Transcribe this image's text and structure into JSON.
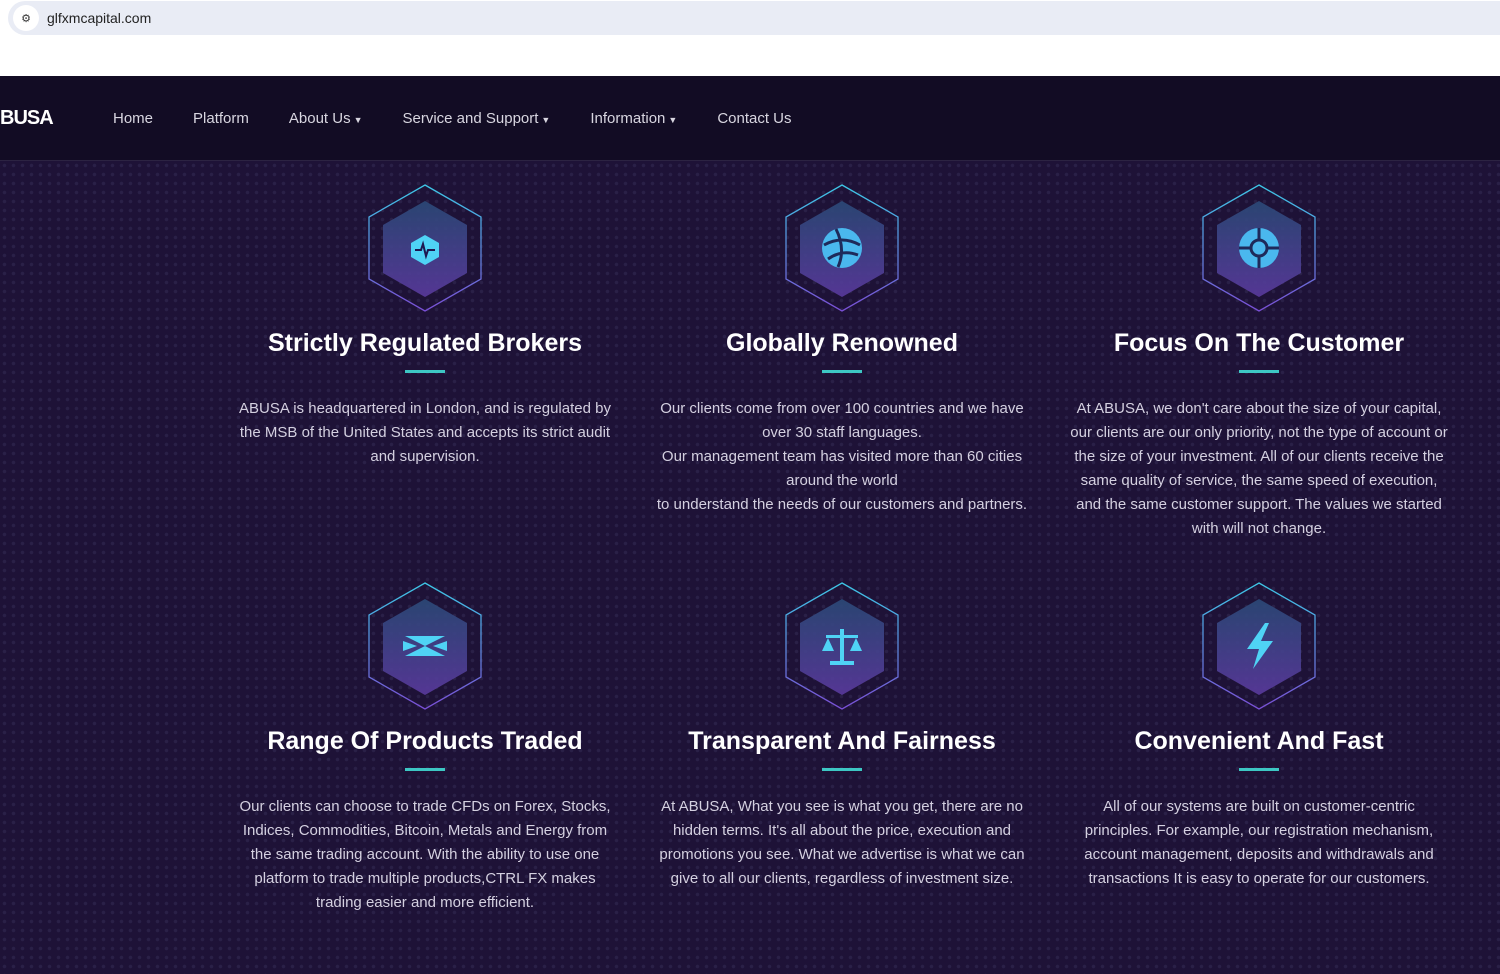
{
  "browser": {
    "url": "glfxmcapital.com"
  },
  "nav": {
    "logo": "BUSA",
    "items": [
      {
        "label": "Home",
        "dropdown": false
      },
      {
        "label": "Platform",
        "dropdown": false
      },
      {
        "label": "About Us",
        "dropdown": true
      },
      {
        "label": "Service and Support",
        "dropdown": true
      },
      {
        "label": "Information",
        "dropdown": true
      },
      {
        "label": "Contact Us",
        "dropdown": false
      }
    ]
  },
  "features": [
    {
      "icon": "pulse-shield-icon",
      "title": "Strictly Regulated Brokers",
      "text": "ABUSA is headquartered in London, and is regulated by the MSB of the United States and accepts its strict audit and supervision."
    },
    {
      "icon": "globe-icon",
      "title": "Globally Renowned",
      "text": "Our clients come from over 100 countries and we have over 30 staff languages.\nOur management team has visited more than 60 cities around the world\nto understand the needs of our customers and partners."
    },
    {
      "icon": "target-icon",
      "title": "Focus On The Customer",
      "text": "At ABUSA, we don't care about the size of your capital, our clients are our only priority, not the type of account or the size of your investment. All of our clients receive the same quality of service, the same speed of execution, and the same customer support. The values we started with will not change."
    },
    {
      "icon": "exchange-icon",
      "title": "Range Of Products Traded",
      "text": "Our clients can choose to trade CFDs on Forex, Stocks, Indices, Commodities, Bitcoin, Metals and Energy from the same trading account. With the ability to use one platform to trade multiple products,CTRL FX makes trading easier and more efficient."
    },
    {
      "icon": "scales-icon",
      "title": "Transparent And Fairness",
      "text": "At ABUSA, What you see is what you get, there are no hidden terms. It's all about the price, execution and promotions you see. What we advertise is what we can give to all our clients, regardless of investment size."
    },
    {
      "icon": "lightning-icon",
      "title": "Convenient And Fast",
      "text": "All of our systems are built on customer-centric principles. For example, our registration mechanism, account management, deposits and withdrawals and transactions It is easy to operate for our customers."
    }
  ]
}
